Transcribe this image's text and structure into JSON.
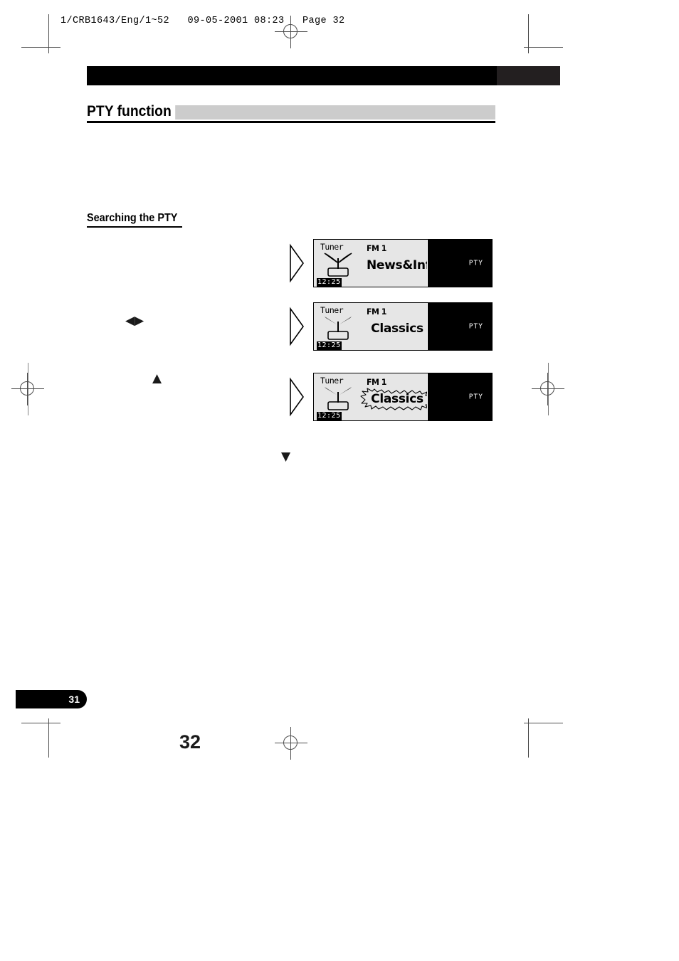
{
  "imprint": "1/CRB1643/Eng/1~52   09-05-2001 08:23   Page 32",
  "section": {
    "title": "PTY function",
    "subheading": "Searching the PTY"
  },
  "margin_glyphs": {
    "left_right_arrows": "◀▶",
    "up_arrow": "▲",
    "down_arrow": "▼"
  },
  "figures": [
    {
      "name": "pty-display-news",
      "source_label": "Tuner",
      "clock": "12:25",
      "band": "FM 1",
      "pty_name": "News&Inf",
      "blinking": false,
      "button_label": "PTY",
      "icon": "antenna-icon"
    },
    {
      "name": "pty-display-classics",
      "source_label": "Tuner",
      "clock": "12:25",
      "band": "FM 1",
      "pty_name": "Classics",
      "blinking": false,
      "button_label": "PTY",
      "icon": "antenna-icon"
    },
    {
      "name": "pty-display-classics-blinking",
      "source_label": "Tuner",
      "clock": "12:25",
      "band": "FM 1",
      "pty_name": "Classics",
      "blinking": true,
      "button_label": "PTY",
      "icon": "antenna-icon"
    }
  ],
  "footer": {
    "chapter_tab": "31",
    "folio": "32"
  },
  "colors": {
    "banner_black": "#000000",
    "banner_gray": "#231f20",
    "title_bar_gray": "#cccccc",
    "lcd_background": "#e6e6e6",
    "lcd_panel_black": "#000000"
  }
}
